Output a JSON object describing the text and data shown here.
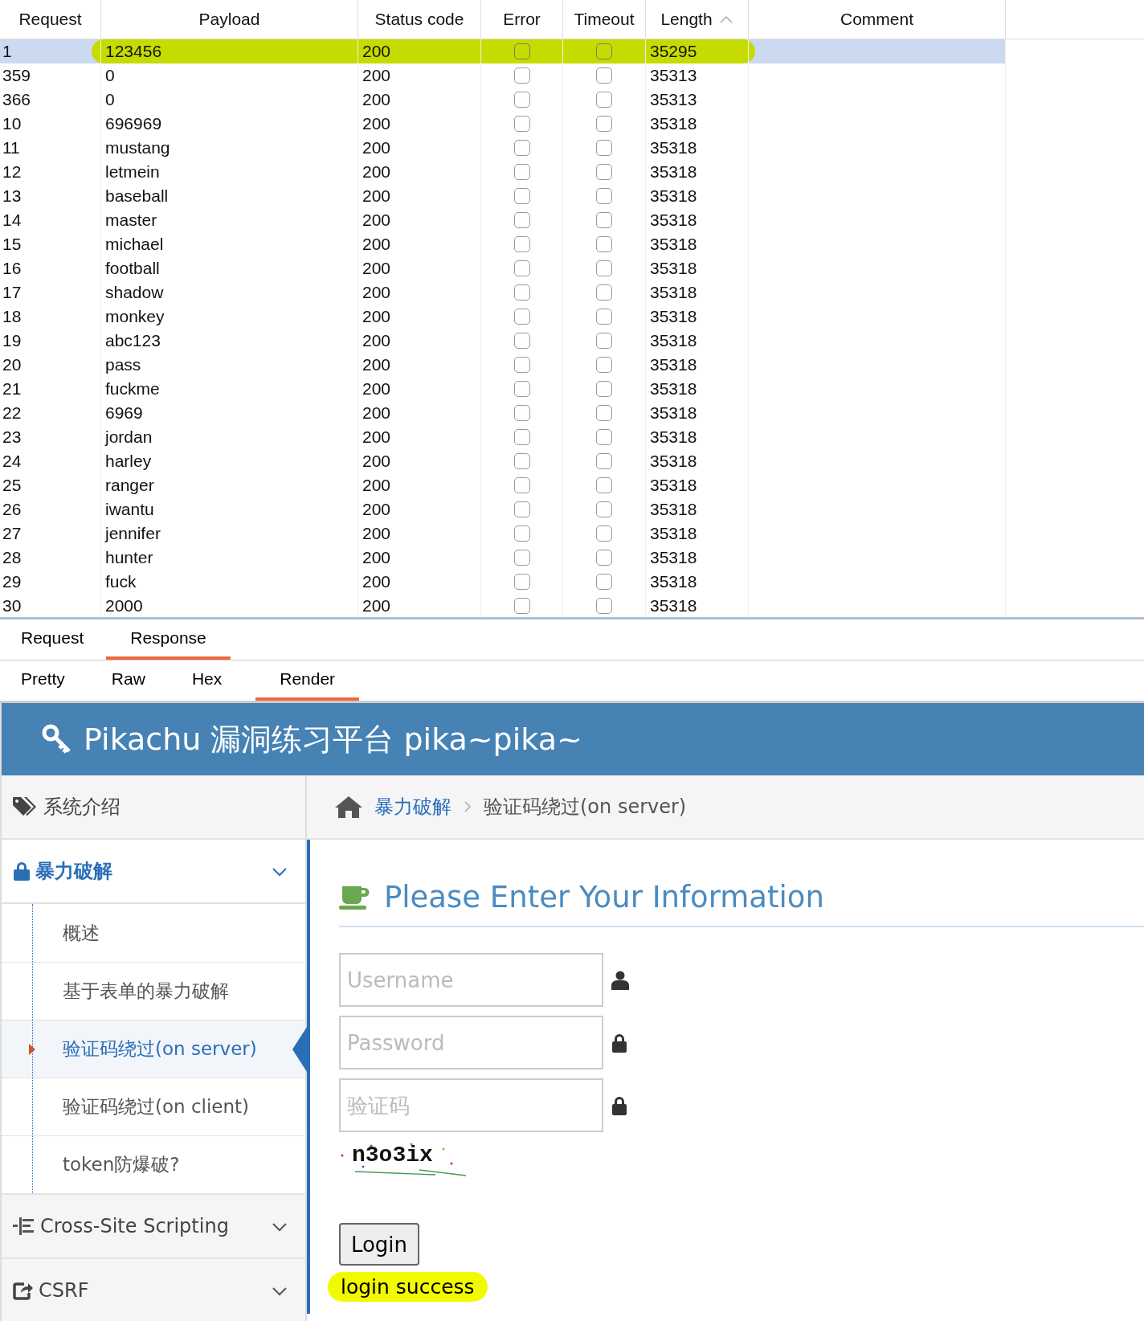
{
  "results_table": {
    "columns": [
      {
        "label": "Request",
        "sorted": false
      },
      {
        "label": "Payload",
        "sorted": false
      },
      {
        "label": "Status code",
        "sorted": false
      },
      {
        "label": "Error",
        "sorted": false
      },
      {
        "label": "Timeout",
        "sorted": false
      },
      {
        "label": "Length",
        "sorted": true
      },
      {
        "label": "Comment",
        "sorted": false
      }
    ],
    "rows": [
      {
        "request": "1",
        "payload": "123456",
        "status_code": "200",
        "error": false,
        "timeout": false,
        "length": "35295",
        "selected": true,
        "highlighted": true
      },
      {
        "request": "359",
        "payload": "0",
        "status_code": "200",
        "error": false,
        "timeout": false,
        "length": "35313",
        "selected": false,
        "highlighted": false
      },
      {
        "request": "366",
        "payload": "0",
        "status_code": "200",
        "error": false,
        "timeout": false,
        "length": "35313",
        "selected": false,
        "highlighted": false
      },
      {
        "request": "10",
        "payload": "696969",
        "status_code": "200",
        "error": false,
        "timeout": false,
        "length": "35318",
        "selected": false,
        "highlighted": false
      },
      {
        "request": "11",
        "payload": "mustang",
        "status_code": "200",
        "error": false,
        "timeout": false,
        "length": "35318",
        "selected": false,
        "highlighted": false
      },
      {
        "request": "12",
        "payload": "letmein",
        "status_code": "200",
        "error": false,
        "timeout": false,
        "length": "35318",
        "selected": false,
        "highlighted": false
      },
      {
        "request": "13",
        "payload": "baseball",
        "status_code": "200",
        "error": false,
        "timeout": false,
        "length": "35318",
        "selected": false,
        "highlighted": false
      },
      {
        "request": "14",
        "payload": "master",
        "status_code": "200",
        "error": false,
        "timeout": false,
        "length": "35318",
        "selected": false,
        "highlighted": false
      },
      {
        "request": "15",
        "payload": "michael",
        "status_code": "200",
        "error": false,
        "timeout": false,
        "length": "35318",
        "selected": false,
        "highlighted": false
      },
      {
        "request": "16",
        "payload": "football",
        "status_code": "200",
        "error": false,
        "timeout": false,
        "length": "35318",
        "selected": false,
        "highlighted": false
      },
      {
        "request": "17",
        "payload": "shadow",
        "status_code": "200",
        "error": false,
        "timeout": false,
        "length": "35318",
        "selected": false,
        "highlighted": false
      },
      {
        "request": "18",
        "payload": "monkey",
        "status_code": "200",
        "error": false,
        "timeout": false,
        "length": "35318",
        "selected": false,
        "highlighted": false
      },
      {
        "request": "19",
        "payload": "abc123",
        "status_code": "200",
        "error": false,
        "timeout": false,
        "length": "35318",
        "selected": false,
        "highlighted": false
      },
      {
        "request": "20",
        "payload": "pass",
        "status_code": "200",
        "error": false,
        "timeout": false,
        "length": "35318",
        "selected": false,
        "highlighted": false
      },
      {
        "request": "21",
        "payload": "fuckme",
        "status_code": "200",
        "error": false,
        "timeout": false,
        "length": "35318",
        "selected": false,
        "highlighted": false
      },
      {
        "request": "22",
        "payload": "6969",
        "status_code": "200",
        "error": false,
        "timeout": false,
        "length": "35318",
        "selected": false,
        "highlighted": false
      },
      {
        "request": "23",
        "payload": "jordan",
        "status_code": "200",
        "error": false,
        "timeout": false,
        "length": "35318",
        "selected": false,
        "highlighted": false
      },
      {
        "request": "24",
        "payload": "harley",
        "status_code": "200",
        "error": false,
        "timeout": false,
        "length": "35318",
        "selected": false,
        "highlighted": false
      },
      {
        "request": "25",
        "payload": "ranger",
        "status_code": "200",
        "error": false,
        "timeout": false,
        "length": "35318",
        "selected": false,
        "highlighted": false
      },
      {
        "request": "26",
        "payload": "iwantu",
        "status_code": "200",
        "error": false,
        "timeout": false,
        "length": "35318",
        "selected": false,
        "highlighted": false
      },
      {
        "request": "27",
        "payload": "jennifer",
        "status_code": "200",
        "error": false,
        "timeout": false,
        "length": "35318",
        "selected": false,
        "highlighted": false
      },
      {
        "request": "28",
        "payload": "hunter",
        "status_code": "200",
        "error": false,
        "timeout": false,
        "length": "35318",
        "selected": false,
        "highlighted": false
      },
      {
        "request": "29",
        "payload": "fuck",
        "status_code": "200",
        "error": false,
        "timeout": false,
        "length": "35318",
        "selected": false,
        "highlighted": false
      },
      {
        "request": "30",
        "payload": "2000",
        "status_code": "200",
        "error": false,
        "timeout": false,
        "length": "35318",
        "selected": false,
        "highlighted": false
      }
    ]
  },
  "message_tabs": [
    {
      "label": "Request",
      "selected": false
    },
    {
      "label": "Response",
      "selected": true
    }
  ],
  "view_tabs": [
    {
      "label": "Pretty",
      "selected": false
    },
    {
      "label": "Raw",
      "selected": false
    },
    {
      "label": "Hex",
      "selected": false
    },
    {
      "label": "Render",
      "selected": true
    }
  ],
  "rendered_page": {
    "site_title": "Pikachu 漏洞练习平台 pika~pika~",
    "sidebar": [
      {
        "label": "系统介绍",
        "expanded": false,
        "has_caret": false
      },
      {
        "label": "暴力破解",
        "expanded": true,
        "has_caret": true,
        "children": [
          {
            "label": "概述",
            "selected": false
          },
          {
            "label": "基于表单的暴力破解",
            "selected": false
          },
          {
            "label": "验证码绕过(on server)",
            "selected": true
          },
          {
            "label": "验证码绕过(on client)",
            "selected": false
          },
          {
            "label": "token防爆破?",
            "selected": false
          }
        ]
      },
      {
        "label": "Cross-Site Scripting",
        "expanded": false,
        "has_caret": true
      },
      {
        "label": "CSRF",
        "expanded": false,
        "has_caret": true
      }
    ],
    "breadcrumb": [
      "暴力破解",
      "验证码绕过(on server)"
    ],
    "heading": "Please Enter Your Information",
    "fields": [
      {
        "placeholder": "Username"
      },
      {
        "placeholder": "Password"
      },
      {
        "placeholder": "验证码"
      }
    ],
    "captcha": "n3o3ix",
    "login_button": "Login",
    "message": {
      "text": "login success",
      "highlighted": true
    }
  }
}
